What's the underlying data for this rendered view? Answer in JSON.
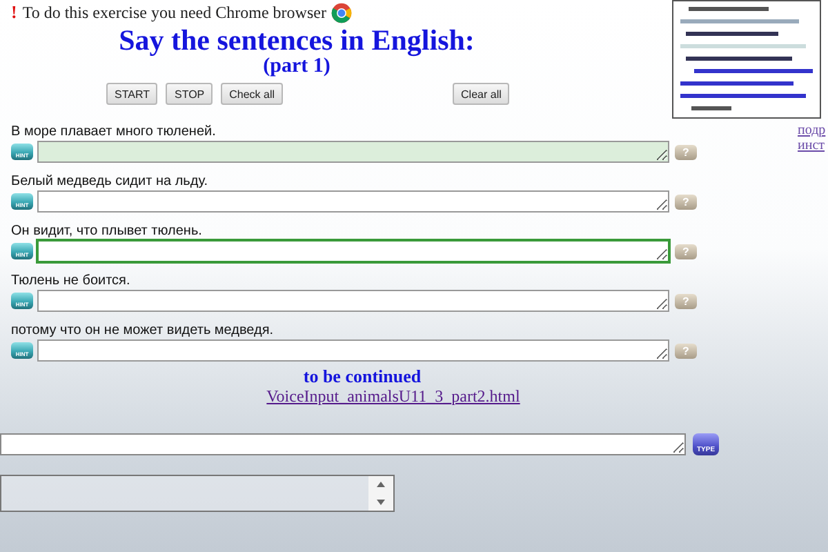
{
  "notice": {
    "mark": "!",
    "text": "To do this exercise you need Chrome browser"
  },
  "title": "Say the sentences in English:",
  "subtitle": "(part 1)",
  "controls": [
    {
      "label": "START"
    },
    {
      "label": "STOP"
    },
    {
      "label": "Check all"
    }
  ],
  "clear_button": "Clear all",
  "sentences": [
    {
      "prompt": "В море плавает много тюленей.",
      "hint_label": "HINT",
      "help_label": "?",
      "correct": true,
      "focused": false
    },
    {
      "prompt": "Белый медведь сидит на льду.",
      "hint_label": "HINT",
      "help_label": "?",
      "correct": false,
      "focused": false
    },
    {
      "prompt": "Он видит, что плывет тюлень.",
      "hint_label": "HINT",
      "help_label": "?",
      "correct": false,
      "focused": true
    },
    {
      "prompt": "Тюлень не боится.",
      "hint_label": "HINT",
      "help_label": "?",
      "correct": false,
      "focused": false
    },
    {
      "prompt": "потому что он не может видеть медведя.",
      "hint_label": "HINT",
      "help_label": "?",
      "correct": false,
      "focused": false
    }
  ],
  "side_links": [
    "подр",
    "инст"
  ],
  "continued": "to be continued",
  "next_link": "VoiceInput_animalsU11_3_part2.html",
  "type_button": "TYPE"
}
